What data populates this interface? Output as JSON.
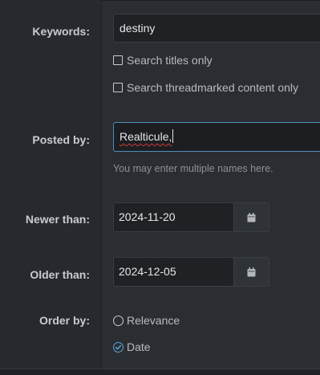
{
  "form": {
    "keywords": {
      "label": "Keywords:",
      "value": "destiny",
      "options": [
        {
          "label": "Search titles only",
          "checked": false
        },
        {
          "label": "Search threadmarked content only",
          "checked": false
        }
      ]
    },
    "posted_by": {
      "label": "Posted by:",
      "value": "Realticule,",
      "hint": "You may enter multiple names here."
    },
    "newer_than": {
      "label": "Newer than:",
      "value": "2024-11-20",
      "icon": "calendar-icon"
    },
    "older_than": {
      "label": "Older than:",
      "value": "2024-12-05",
      "icon": "calendar-icon"
    },
    "order_by": {
      "label": "Order by:",
      "options": [
        {
          "label": "Relevance",
          "selected": false
        },
        {
          "label": "Date",
          "selected": true
        }
      ]
    }
  },
  "colors": {
    "accent": "#5aa6d8",
    "focus_border": "#4e8fb8",
    "spellcheck": "#d23b3b"
  }
}
